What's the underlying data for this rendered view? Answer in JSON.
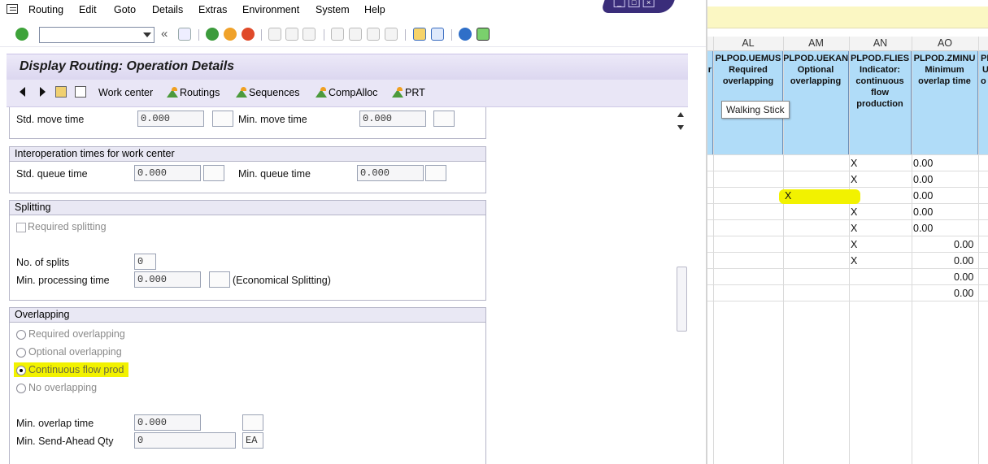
{
  "menu": [
    "Routing",
    "Edit",
    "Goto",
    "Details",
    "Extras",
    "Environment",
    "System",
    "Help"
  ],
  "toolbar": {
    "command_value": "",
    "nav_back": "«"
  },
  "page_title": "Display Routing: Operation Details",
  "app_toolbar": [
    "Work center",
    "Routings",
    "Sequences",
    "CompAlloc",
    "PRT"
  ],
  "move": {
    "std_label": "Std. move time",
    "std_value": "0.000",
    "min_label": "Min. move time",
    "min_value": "0.000"
  },
  "interop": {
    "title": "Interoperation times for work center",
    "std_label": "Std. queue time",
    "std_value": "0.000",
    "min_label": "Min. queue time",
    "min_value": "0.000"
  },
  "splitting": {
    "title": "Splitting",
    "required_label": "Required splitting",
    "splits_label": "No. of splits",
    "splits_value": "0",
    "min_proc_label": "Min. processing time",
    "min_proc_value": "0.000",
    "econ_label": "(Economical Splitting)"
  },
  "overlapping": {
    "title": "Overlapping",
    "options": [
      "Required overlapping",
      "Optional overlapping",
      "Continuous flow prod",
      "No overlapping"
    ],
    "selected": "Continuous flow prod",
    "min_overlap_label": "Min. overlap time",
    "min_overlap_value": "0.000",
    "send_ahead_label": "Min. Send-Ahead Qty",
    "send_ahead_value": "0",
    "send_ahead_unit": "EA"
  },
  "excel": {
    "columns": [
      "AL",
      "AM",
      "AN",
      "AO"
    ],
    "headers": [
      {
        "code": "PLPOD.UEMUS",
        "desc": "Required overlapping"
      },
      {
        "code": "PLPOD.UEKAN",
        "desc": "Optional overlapping"
      },
      {
        "code": "PLPOD.FLIES",
        "desc": "Indicator: continuous flow production"
      },
      {
        "code": "PLPOD.ZMINU",
        "desc": "Minimum overlap time"
      }
    ],
    "clipped_left": "r",
    "clipped_right_top": "PL",
    "clipped_right_mid": "U",
    "clipped_right_bot": "o",
    "tooltip": "Walking Stick",
    "rows": [
      {
        "am": "",
        "an": "X",
        "ao": "0.00"
      },
      {
        "am": "",
        "an": "X",
        "ao": "0.00"
      },
      {
        "am": "X",
        "an": "",
        "ao": "0.00"
      },
      {
        "am": "",
        "an": "X",
        "ao": "0.00"
      },
      {
        "am": "",
        "an": "X",
        "ao": "0.00"
      },
      {
        "am": "",
        "an": "X",
        "ao": "0.00"
      },
      {
        "am": "",
        "an": "X",
        "ao": "0.00"
      },
      {
        "am": "",
        "an": "",
        "ao": "0.00"
      },
      {
        "am": "",
        "an": "",
        "ao": "0.00"
      }
    ],
    "highlight_color": "#f2f200"
  }
}
